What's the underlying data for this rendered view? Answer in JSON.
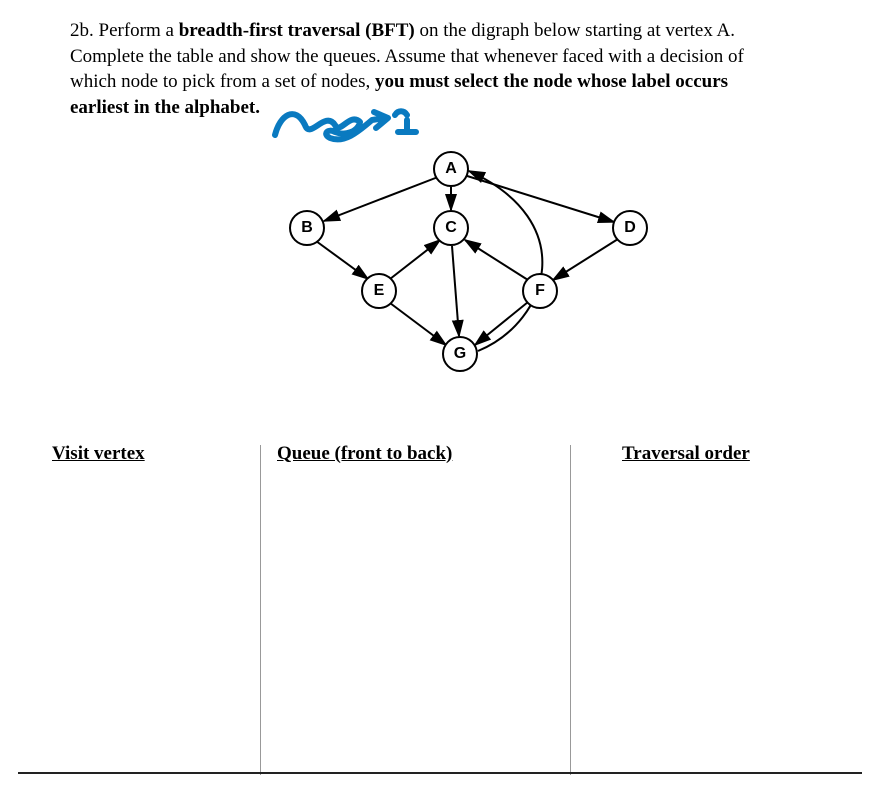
{
  "question": {
    "number": "2b.",
    "line1_pre": "Perform a ",
    "line1_bold": "breadth-first traversal (BFT)",
    "line1_post": " on the digraph below starting at vertex A.",
    "line2": "Complete the table and show the queues. Assume that whenever faced with a decision of",
    "line3_pre": "which node to pick from a set of nodes, ",
    "line3_bold": "you must select the node whose label occurs",
    "line4_bold": "earliest in the alphabet."
  },
  "vertices": {
    "A": "A",
    "B": "B",
    "C": "C",
    "D": "D",
    "E": "E",
    "F": "F",
    "G": "G"
  },
  "headers": {
    "visit": "Visit vertex",
    "queue": "Queue (front to back)",
    "order": "Traversal order"
  }
}
